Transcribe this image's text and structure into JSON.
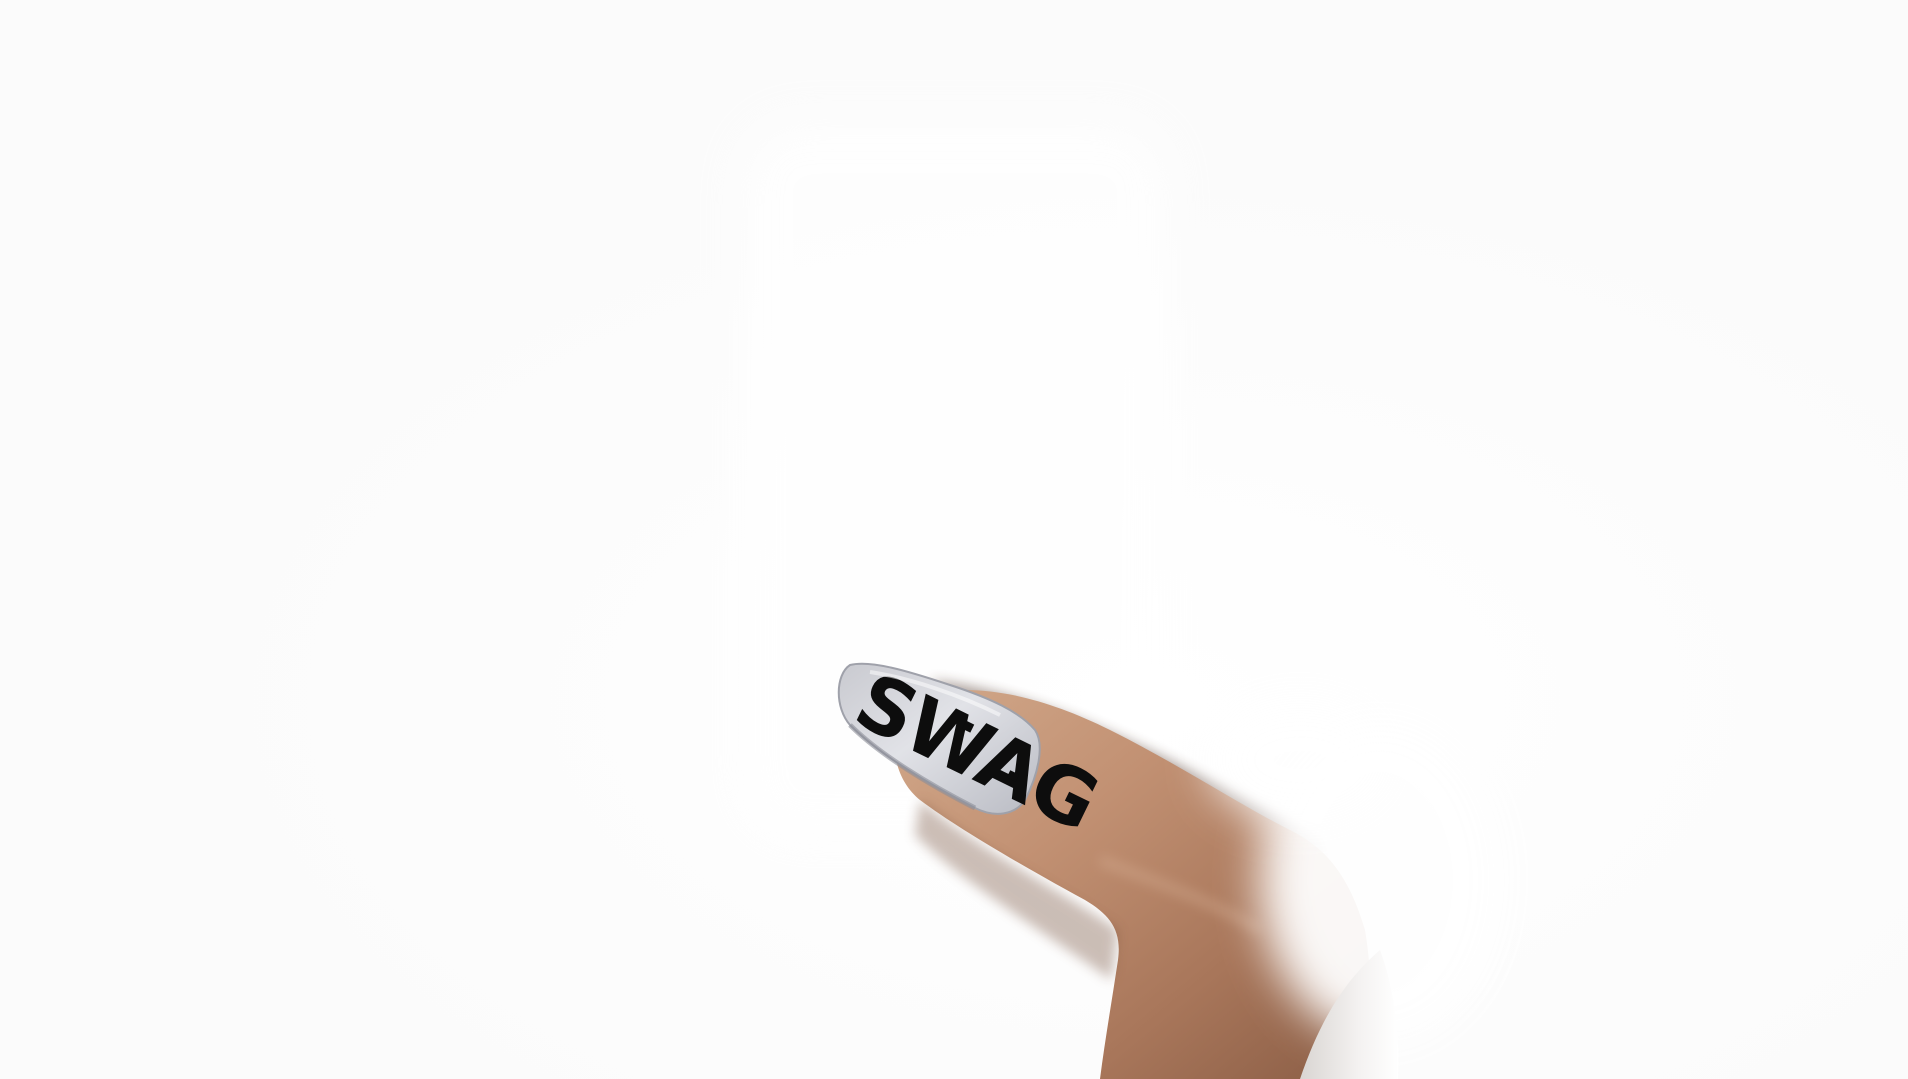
{
  "photo": {
    "subject": "",
    "nail_text": "SWAG",
    "colors": {
      "background": "#fdfdfd",
      "skin_light": "#caa184",
      "skin_mid": "#b07e60",
      "skin_shadow": "#7a4f38",
      "nail_base": "#dcdde2",
      "nail_edge": "#a8aab3",
      "lettering": "#0d0d0d",
      "sleeve": "#f1efee"
    }
  }
}
